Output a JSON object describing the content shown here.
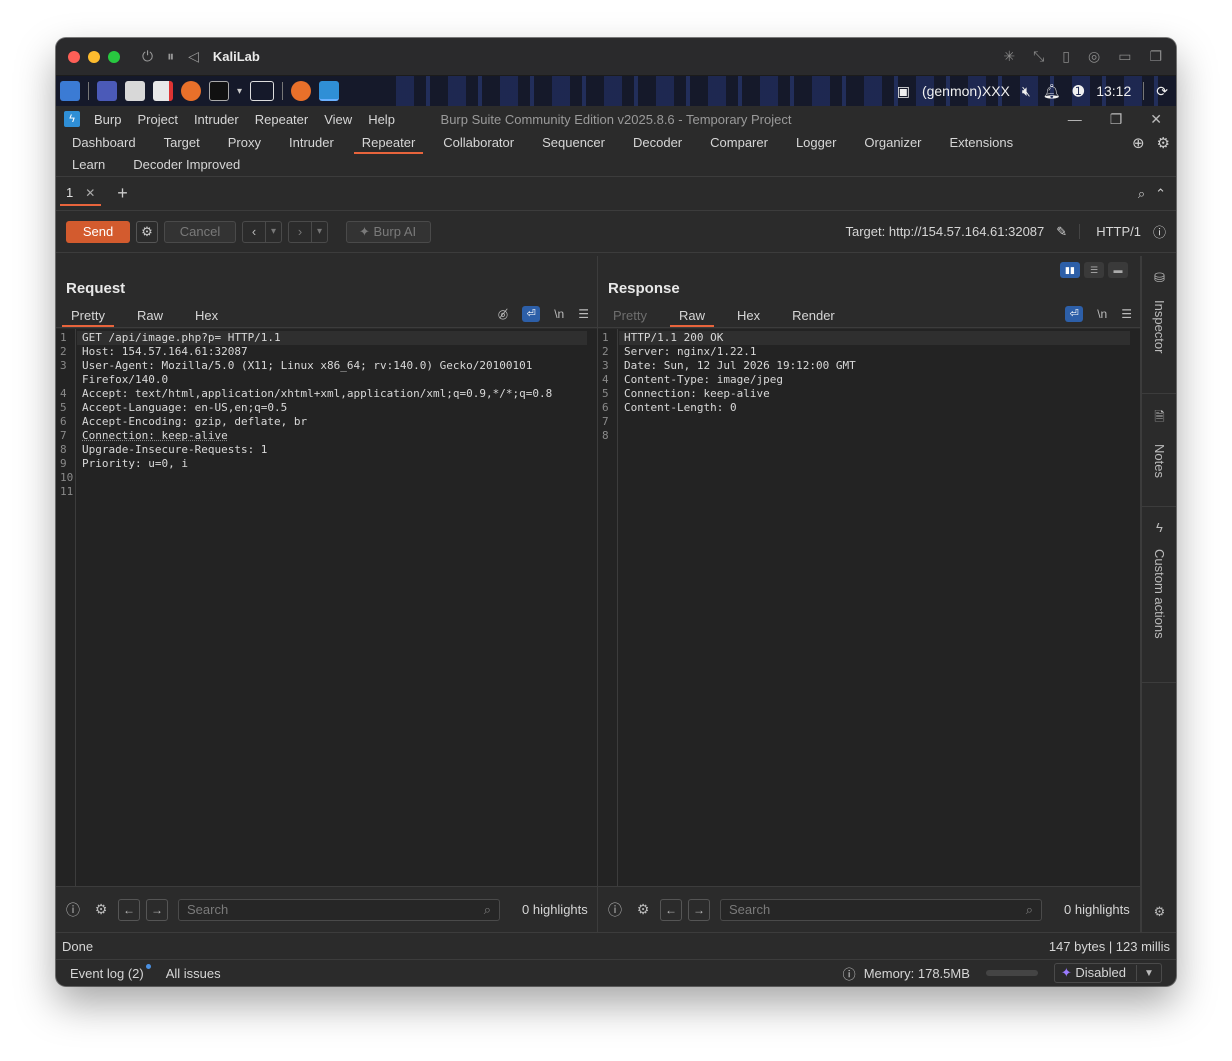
{
  "mac": {
    "title": "KaliLab"
  },
  "kali_panel": {
    "user": "(genmon)XXX",
    "clock": "13:12"
  },
  "burp": {
    "window_title": "Burp Suite Community Edition v2025.8.6 - Temporary Project",
    "menu": [
      "Burp",
      "Project",
      "Intruder",
      "Repeater",
      "View",
      "Help"
    ]
  },
  "main_tabs": [
    "Dashboard",
    "Target",
    "Proxy",
    "Intruder",
    "Repeater",
    "Collaborator",
    "Sequencer",
    "Decoder",
    "Comparer",
    "Logger",
    "Organizer",
    "Extensions",
    "Learn",
    "Decoder Improved"
  ],
  "active_main_tab": "Repeater",
  "repeater_tab": {
    "label": "1"
  },
  "toolbar": {
    "send": "Send",
    "cancel": "Cancel",
    "burp_ai": "Burp AI",
    "target": "Target: http://154.57.164.61:32087",
    "protocol": "HTTP/1"
  },
  "request": {
    "title": "Request",
    "tabs": [
      "Pretty",
      "Raw",
      "Hex"
    ],
    "active_tab": "Pretty",
    "lines": [
      "GET /api/image.php?p= HTTP/1.1",
      "Host: 154.57.164.61:32087",
      "User-Agent: Mozilla/5.0 (X11; Linux x86_64; rv:140.0) Gecko/20100101",
      "Firefox/140.0",
      "Accept: text/html,application/xhtml+xml,application/xml;q=0.9,*/*;q=0.8",
      "Accept-Language: en-US,en;q=0.5",
      "Accept-Encoding: gzip, deflate, br",
      "Connection: keep-alive",
      "Upgrade-Insecure-Requests: 1",
      "Priority: u=0, i",
      "",
      ""
    ],
    "line_numbers": [
      "1",
      "2",
      "3",
      "",
      "4",
      "5",
      "6",
      "7",
      "8",
      "9",
      "10",
      "11"
    ],
    "search_placeholder": "Search",
    "highlights": "0 highlights"
  },
  "response": {
    "title": "Response",
    "tabs": [
      "Pretty",
      "Raw",
      "Hex",
      "Render"
    ],
    "active_tab": "Raw",
    "lines": [
      "HTTP/1.1 200 OK",
      "Server: nginx/1.22.1",
      "Date: Sun, 12 Jul 2026 19:12:00 GMT",
      "Content-Type: image/jpeg",
      "Connection: keep-alive",
      "Content-Length: 0",
      "",
      ""
    ],
    "line_numbers": [
      "1",
      "2",
      "3",
      "4",
      "5",
      "6",
      "7",
      "8"
    ],
    "search_placeholder": "Search",
    "highlights": "0 highlights"
  },
  "sidebar": [
    "Inspector",
    "Notes",
    "Custom actions"
  ],
  "status": {
    "left": "Done",
    "right": "147 bytes | 123 millis"
  },
  "bottom": {
    "event_log": "Event log (2)",
    "all_issues": "All issues",
    "memory": "Memory: 178.5MB",
    "ai_state": "Disabled"
  },
  "colors": {
    "accent": "#e8643c",
    "send": "#d35b2e",
    "toggle_on": "#2d5fa8"
  }
}
